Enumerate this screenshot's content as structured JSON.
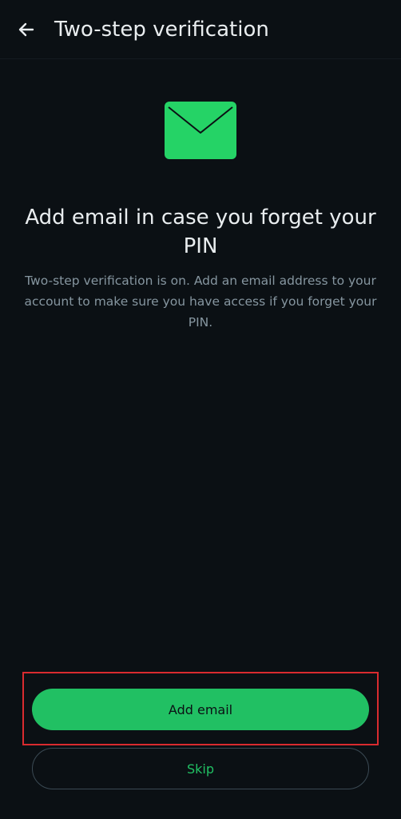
{
  "header": {
    "title": "Two-step verification",
    "back_icon": "arrow-left-icon"
  },
  "hero": {
    "icon": "envelope-icon",
    "icon_color": "#25d366"
  },
  "content": {
    "title": "Add email in case you forget your PIN",
    "description": "Two-step verification is on. Add an email address to your account to make sure you have access if you forget your PIN."
  },
  "actions": {
    "add_email_label": "Add email",
    "skip_label": "Skip"
  },
  "colors": {
    "background": "#0b1014",
    "accent": "#21c063",
    "text_primary": "#e9edef",
    "text_secondary": "#8696a0",
    "highlight": "#d92b2f"
  }
}
